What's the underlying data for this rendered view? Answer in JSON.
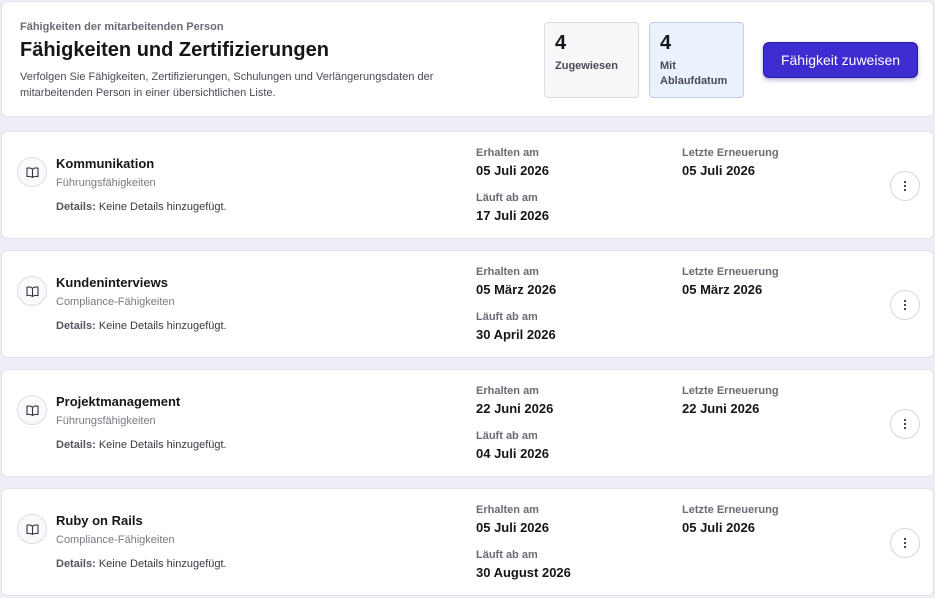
{
  "header": {
    "eyebrow": "Fähigkeiten der mitarbeitenden Person",
    "title": "Fähigkeiten und Zertifizierungen",
    "description": "Verfolgen Sie Fähigkeiten, Zertifizierungen, Schulungen und Verlängerungsdaten der mitarbeitenden Person in einer übersichtlichen Liste.",
    "stats": [
      {
        "value": "4",
        "label": "Zugewiesen"
      },
      {
        "value": "4",
        "label": "Mit Ablaufdatum"
      }
    ],
    "assign_button": "Fähigkeit zuweisen"
  },
  "labels": {
    "details": "Details:",
    "obtained": "Erhalten am",
    "expires": "Läuft ab am",
    "renewal": "Letzte Erneuerung"
  },
  "skills": [
    {
      "name": "Kommunikation",
      "category": "Führungsfähigkeiten",
      "details": "Keine Details hinzugefügt.",
      "obtained": "05 Juli 2026",
      "expires": "17 Juli 2026",
      "renewal": "05 Juli 2026"
    },
    {
      "name": "Kundeninterviews",
      "category": "Compliance-Fähigkeiten",
      "details": "Keine Details hinzugefügt.",
      "obtained": "05 März 2026",
      "expires": "30 April 2026",
      "renewal": "05 März 2026"
    },
    {
      "name": "Projektmanagement",
      "category": "Führungsfähigkeiten",
      "details": "Keine Details hinzugefügt.",
      "obtained": "22 Juni 2026",
      "expires": "04 Juli 2026",
      "renewal": "22 Juni 2026"
    },
    {
      "name": "Ruby on Rails",
      "category": "Compliance-Fähigkeiten",
      "details": "Keine Details hinzugefügt.",
      "obtained": "05 Juli 2026",
      "expires": "30 August 2026",
      "renewal": "05 Juli 2026"
    }
  ],
  "icons": {
    "skill": "book-icon",
    "menu": "more-vertical-icon"
  },
  "colors": {
    "accent": "#3d2ccf",
    "expiry_highlight": "#eaf2fd"
  }
}
